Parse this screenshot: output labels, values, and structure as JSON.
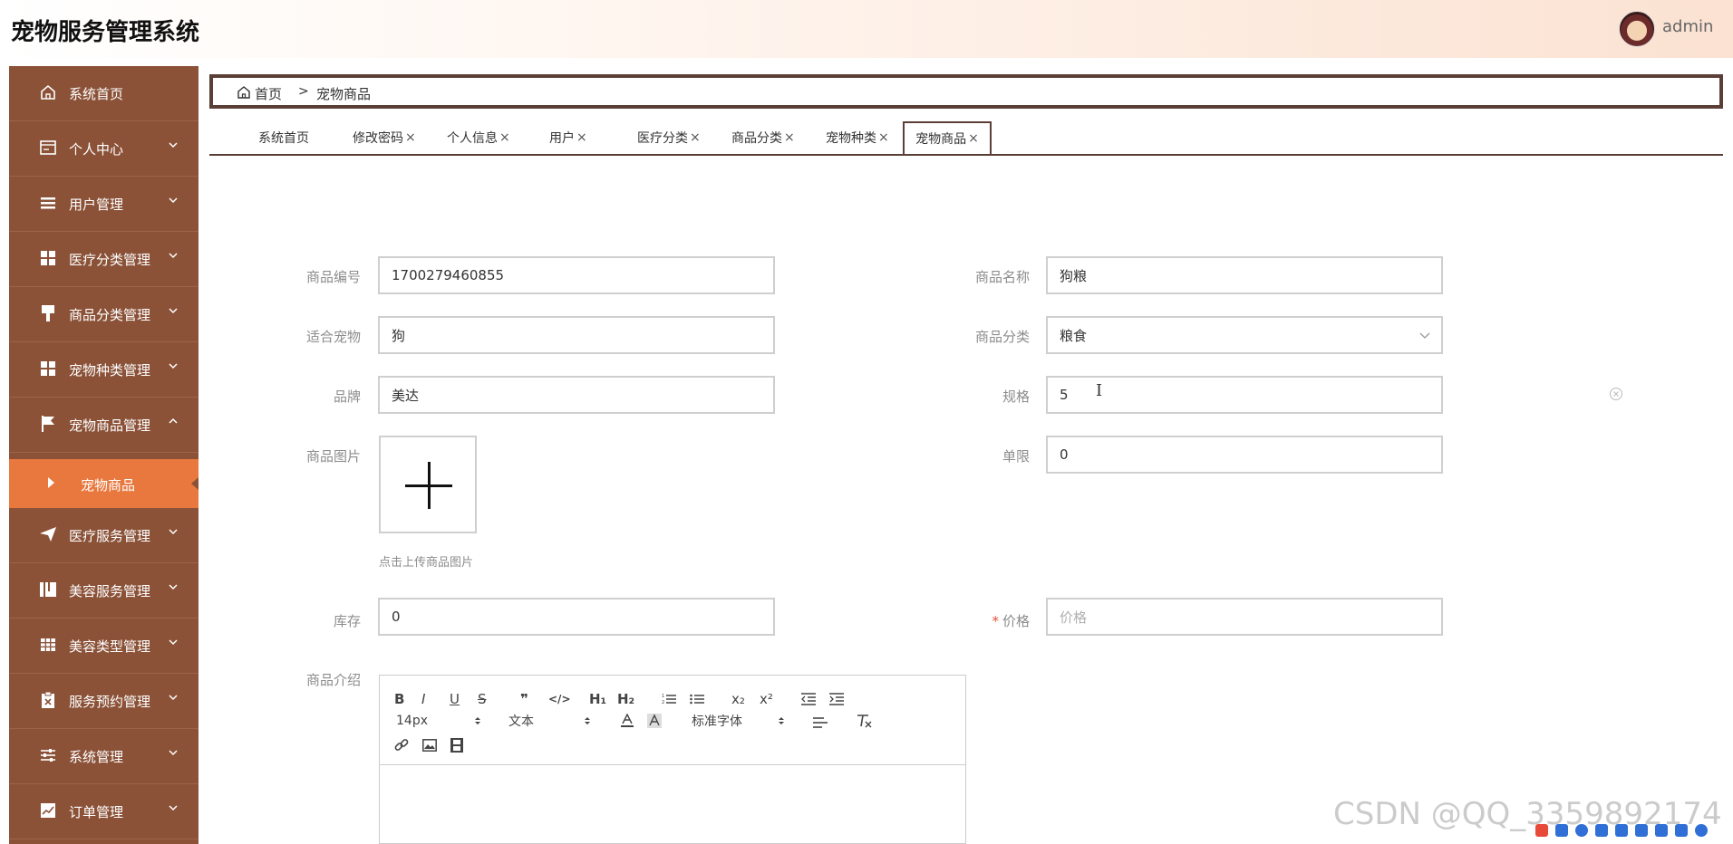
{
  "app": {
    "title": "宠物服务管理系统",
    "user": "admin"
  },
  "sidebar": {
    "items": [
      {
        "label": "系统首页",
        "icon": "home-icon",
        "chevron": "none"
      },
      {
        "label": "个人中心",
        "icon": "id-card-icon",
        "chevron": "down"
      },
      {
        "label": "用户管理",
        "icon": "list-icon",
        "chevron": "down"
      },
      {
        "label": "医疗分类管理",
        "icon": "grid-icon",
        "chevron": "down"
      },
      {
        "label": "商品分类管理",
        "icon": "brush-icon",
        "chevron": "down"
      },
      {
        "label": "宠物种类管理",
        "icon": "grid-icon",
        "chevron": "down"
      },
      {
        "label": "宠物商品管理",
        "icon": "flag-icon",
        "chevron": "up"
      },
      {
        "label": "医疗服务管理",
        "icon": "paper-plane-icon",
        "chevron": "down"
      },
      {
        "label": "美容服务管理",
        "icon": "book-icon",
        "chevron": "down"
      },
      {
        "label": "美容类型管理",
        "icon": "table-icon",
        "chevron": "down"
      },
      {
        "label": "服务预约管理",
        "icon": "clipboard-icon",
        "chevron": "down"
      },
      {
        "label": "系统管理",
        "icon": "sliders-icon",
        "chevron": "down"
      },
      {
        "label": "订单管理",
        "icon": "chart-icon",
        "chevron": "down"
      }
    ],
    "active_sub": "宠物商品"
  },
  "breadcrumb": {
    "home": "首页",
    "separator": ">",
    "current": "宠物商品"
  },
  "tabs": [
    {
      "label": "系统首页",
      "closable": false
    },
    {
      "label": "修改密码",
      "closable": true
    },
    {
      "label": "个人信息",
      "closable": true
    },
    {
      "label": "用户",
      "closable": true
    },
    {
      "label": "医疗分类",
      "closable": true
    },
    {
      "label": "商品分类",
      "closable": true
    },
    {
      "label": "宠物种类",
      "closable": true
    },
    {
      "label": "宠物商品",
      "closable": true,
      "active": true
    }
  ],
  "tab_close": "×",
  "form": {
    "code": {
      "label": "商品编号",
      "value": "1700279460855"
    },
    "name": {
      "label": "商品名称",
      "value": "狗粮"
    },
    "pet": {
      "label": "适合宠物",
      "value": "狗"
    },
    "category": {
      "label": "商品分类",
      "value": "粮食"
    },
    "brand": {
      "label": "品牌",
      "value": "美达"
    },
    "spec": {
      "label": "规格",
      "value": "5"
    },
    "image": {
      "label": "商品图片",
      "hint": "点击上传商品图片"
    },
    "limit": {
      "label": "单限",
      "value": "0"
    },
    "stock": {
      "label": "库存",
      "value": "0"
    },
    "price": {
      "label": "价格",
      "required_mark": "*",
      "placeholder": "价格"
    },
    "intro": {
      "label": "商品介绍"
    }
  },
  "editor": {
    "size": "14px",
    "header": "文本",
    "font": "标准字体",
    "h1": "H₁",
    "h2": "H₂",
    "sub": "x₂",
    "sup": "x²",
    "bold": "B",
    "italic": "I",
    "underline": "U",
    "strike": "S",
    "quote": "❞",
    "code": "</>"
  },
  "cursor_glyph": "I",
  "watermark": "CSDN @QQ_3359892174",
  "colors": {
    "sidebar": "#8b5238",
    "sidebar_active": "#e8783e",
    "frame": "#5b3f37",
    "required": "#e8503c"
  }
}
